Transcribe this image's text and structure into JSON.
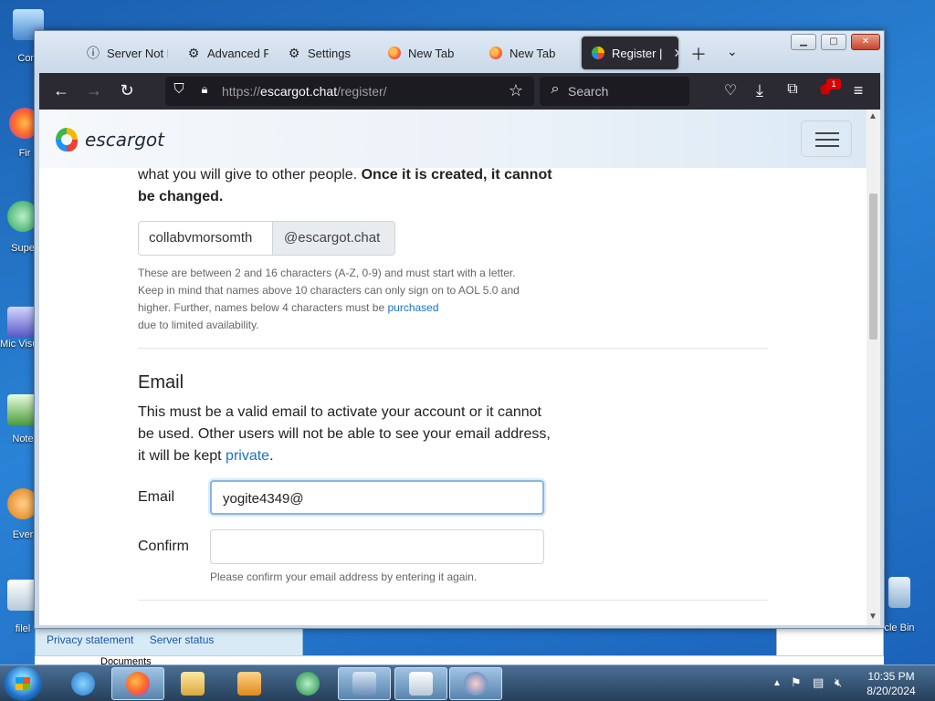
{
  "desktop": {
    "icons": [
      "Com",
      "Fir",
      "Supe",
      "Mic Visual",
      "Note",
      "Ever",
      "filel",
      "cle Bin"
    ],
    "panel_links": [
      "Privacy statement",
      "Server status"
    ],
    "docs_label": "Documents"
  },
  "browser": {
    "tabs": [
      {
        "label": "Server Not F",
        "icon": "info-icon"
      },
      {
        "label": "Advanced P",
        "icon": "gear-icon"
      },
      {
        "label": "Settings",
        "icon": "gear-icon"
      },
      {
        "label": "New Tab",
        "icon": "firefox-icon"
      },
      {
        "label": "New Tab",
        "icon": "firefox-icon"
      },
      {
        "label": "Register |",
        "icon": "escargot-icon"
      }
    ],
    "url_prefix": "https://",
    "url_domain": "escargot.chat",
    "url_path": "/register/",
    "search_placeholder": "Search",
    "extension_badge": "1"
  },
  "page": {
    "logo": "escargot",
    "lead_text": "what you will give to other people.",
    "lead_bold": "Once it is created, it cannot be changed.",
    "username_value": "collabvmorsomth",
    "username_suffix": "@escargot.chat",
    "help_text": "These are between 2 and 16 characters (A-Z, 0-9) and must start with a letter. Keep in mind that names above 10 characters can only sign on to AOL 5.0 and higher. Further, names below 4 characters must be",
    "help_link": "purchased",
    "help_tail": "due to limited availability.",
    "email_section_title": "Email",
    "email_desc": "This must be a valid email to activate your account or it cannot be used. Other users will not be able to see your email address, it will be kept",
    "email_desc_link": "private",
    "email_label": "Email",
    "email_value": "yogite4349@",
    "confirm_label": "Confirm",
    "confirm_value": "",
    "confirm_help": "Please confirm your email address by entering it again."
  },
  "taskbar": {
    "time": "10:35 PM",
    "date": "8/20/2024"
  },
  "colors": {
    "browser_dark": "#2b2a33",
    "link": "#1a73c4",
    "focus": "#86b7e8"
  }
}
